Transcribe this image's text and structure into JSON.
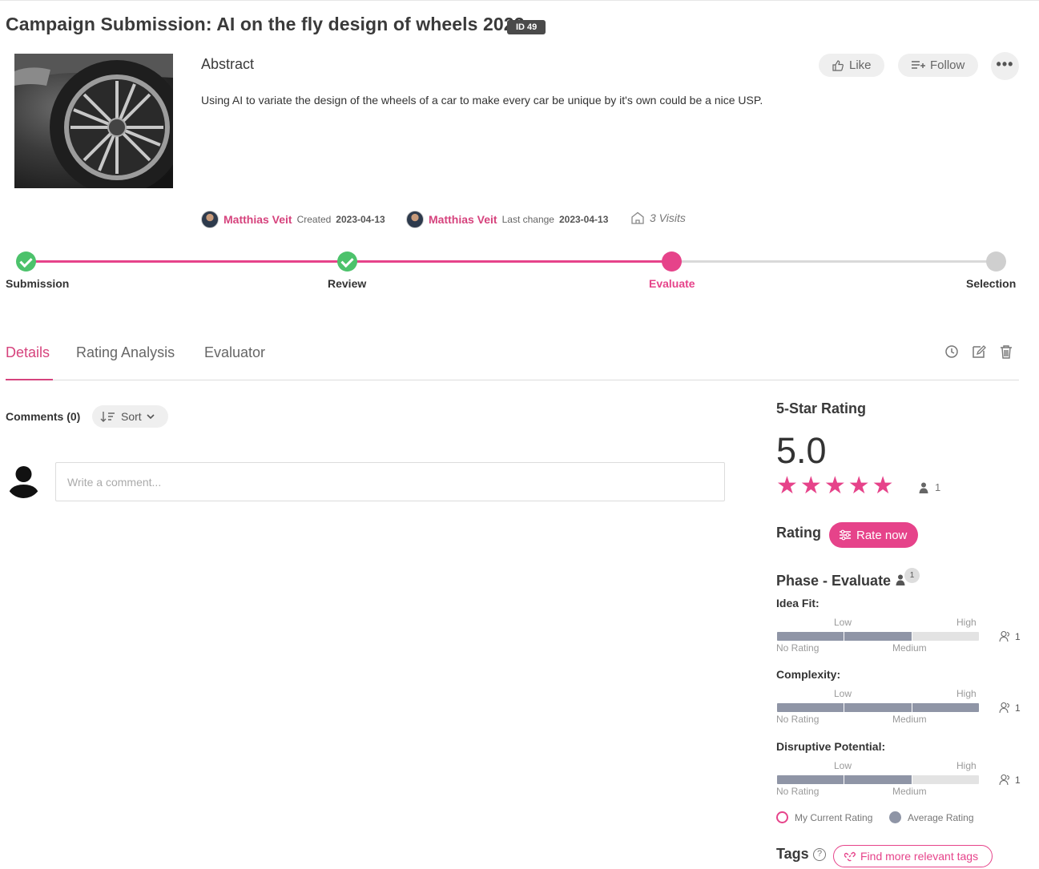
{
  "header": {
    "title": "Campaign Submission: AI on the fly design of wheels 2023",
    "id_badge": "ID 49"
  },
  "abstract": {
    "heading": "Abstract",
    "text": "Using AI to variate the design of the wheels of a car to make every car be unique by it's own could be a nice USP."
  },
  "actions": {
    "like_label": "Like",
    "follow_label": "Follow",
    "more_label": "•••"
  },
  "meta": {
    "creator_name": "Matthias Veit",
    "created_label": "Created",
    "created_date": "2023-04-13",
    "editor_name": "Matthias Veit",
    "last_change_label": "Last change",
    "last_change_date": "2023-04-13",
    "visits": "3 Visits"
  },
  "progress": {
    "steps": [
      {
        "label": "Submission",
        "state": "done"
      },
      {
        "label": "Review",
        "state": "done"
      },
      {
        "label": "Evaluate",
        "state": "current"
      },
      {
        "label": "Selection",
        "state": "future"
      }
    ]
  },
  "tabs": [
    {
      "label": "Details",
      "active": true
    },
    {
      "label": "Rating Analysis",
      "active": false
    },
    {
      "label": "Evaluator",
      "active": false
    }
  ],
  "toolbar_icons": [
    "history-icon",
    "edit-icon",
    "trash-icon"
  ],
  "comments": {
    "label": "Comments (0)",
    "sort_label": "Sort",
    "placeholder": "Write a comment..."
  },
  "star_rating": {
    "heading": "5-Star Rating",
    "value": "5.0",
    "stars": 5,
    "rater_count": "1"
  },
  "rating": {
    "heading": "Rating",
    "rate_now_label": "Rate now"
  },
  "phase": {
    "heading": "Phase - Evaluate",
    "badge": "1",
    "scale_labels": {
      "no_rating": "No Rating",
      "low": "Low",
      "medium": "Medium",
      "high": "High"
    },
    "criteria": [
      {
        "label": "Idea Fit:",
        "average_fraction": 0.67,
        "count": "1"
      },
      {
        "label": "Complexity:",
        "average_fraction": 1.0,
        "count": "1"
      },
      {
        "label": "Disruptive Potential:",
        "average_fraction": 0.67,
        "count": "1"
      }
    ]
  },
  "legend": {
    "current_label": "My Current Rating",
    "average_label": "Average Rating"
  },
  "tags": {
    "heading": "Tags",
    "help": "?",
    "find_more_label": "Find more relevant tags"
  },
  "colors": {
    "accent_pink": "#e6438a",
    "link_pink": "#d6437d",
    "done_green": "#4cc26b",
    "future_grey": "#cfcfcf",
    "bar_average": "#8f95a6"
  }
}
